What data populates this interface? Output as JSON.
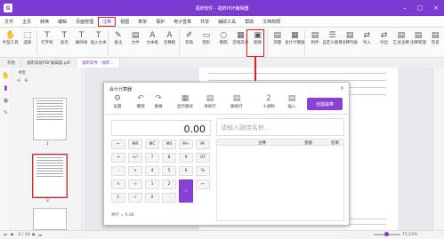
{
  "app": {
    "title": "福昕软件 - 福昕PDF编辑器",
    "logo": "G"
  },
  "menu": [
    "文件",
    "主页",
    "转换",
    "编辑",
    "页面管理",
    "注释",
    "视图",
    "表单",
    "保护",
    "电子签章",
    "共享",
    "辅助工具",
    "帮助",
    "文档权限"
  ],
  "menu_selected_index": 5,
  "ribbon": {
    "items": [
      {
        "icon": "✋",
        "label": "手型工具"
      },
      {
        "icon": "⬚",
        "label": "选择"
      },
      {
        "icon": "T",
        "label": "打字机"
      },
      {
        "icon": "T",
        "label": "高亮"
      },
      {
        "icon": "T",
        "label": "删除线"
      },
      {
        "icon": "T",
        "label": "插入文本"
      },
      {
        "icon": "✎",
        "label": "备注"
      },
      {
        "icon": "▤",
        "label": "文件"
      },
      {
        "icon": "A",
        "label": "文本框"
      },
      {
        "icon": "A",
        "label": "注释框"
      },
      {
        "icon": "✐",
        "label": "铅笔"
      },
      {
        "icon": "▭",
        "label": "矩形"
      },
      {
        "icon": "○",
        "label": "椭圆"
      },
      {
        "icon": "▦",
        "label": "区域高亮"
      },
      {
        "icon": "▣",
        "label": "图章"
      },
      {
        "icon": "▤",
        "label": "测量"
      },
      {
        "icon": "▦",
        "label": "会计计算器"
      },
      {
        "icon": "▤",
        "label": "附件"
      },
      {
        "icon": "☰",
        "label": "自定义图章"
      },
      {
        "icon": "▤",
        "label": "注释列表"
      },
      {
        "icon": "⇄",
        "label": "导入"
      },
      {
        "icon": "⇄",
        "label": "导出"
      },
      {
        "icon": "▤",
        "label": "汇总注释"
      },
      {
        "icon": "▤",
        "label": "注释管理"
      },
      {
        "icon": "▤",
        "label": "签名"
      }
    ],
    "selected_index": 16
  },
  "tabs": [
    "开始",
    "福昕高级PDF编辑器.pdf",
    "福昕软件 - 福昕..."
  ],
  "active_tab": 2,
  "sidebar": {
    "header": "书签",
    "thumb_pages": [
      "1",
      "2"
    ]
  },
  "status": {
    "page": "2 / 14",
    "zoom": "71.23%"
  },
  "calculator": {
    "title": "会计计算器",
    "close": "×",
    "toolbar": [
      {
        "icon": "⚙",
        "label": "设置"
      },
      {
        "icon": "↶",
        "label": "撤销"
      },
      {
        "icon": "↷",
        "label": "重做"
      },
      {
        "icon": "▦",
        "label": "显示模式"
      },
      {
        "icon": "▤",
        "label": "清除行"
      },
      {
        "icon": "▤",
        "label": "删除行"
      },
      {
        "icon": "2",
        "label": "十进制"
      },
      {
        "icon": "▤",
        "label": "插入"
      }
    ],
    "create_button": "创建磁带",
    "display_value": "0.00",
    "keys": [
      [
        "←",
        "MR",
        "MC",
        "MS",
        "M+",
        "M-"
      ],
      [
        "+",
        "+/-",
        "7",
        "8",
        "9",
        "GT"
      ],
      [
        "-",
        "×",
        "4",
        "5",
        "6",
        "%"
      ],
      [
        "×",
        "÷",
        "1",
        "2",
        "3",
        "←"
      ],
      [
        "C",
        "√",
        "0",
        ".",
        "=",
        ""
      ]
    ],
    "history_label": "共计 = 0.00",
    "tape_placeholder": "请输入磁带名称...",
    "tape_columns": [
      "注释",
      "金额",
      "结果"
    ],
    "colors": {
      "accent": "#8a3fd6",
      "highlight": "#e02020"
    }
  }
}
